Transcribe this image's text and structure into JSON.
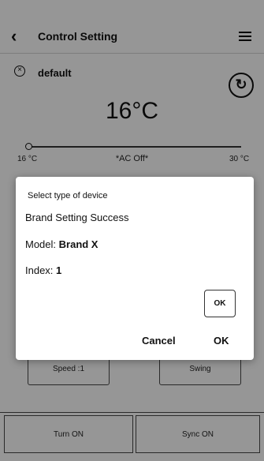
{
  "header": {
    "title": "Control Setting",
    "back_icon": "chevron-left-icon",
    "menu_icon": "hamburger-menu-icon"
  },
  "control": {
    "preset_name": "default",
    "temperature": "16°C",
    "slider_min": "16 °C",
    "slider_max": "30 °C",
    "status": "*AC Off*",
    "slider_value_c": 16
  },
  "buttons": {
    "speed": "Speed :1",
    "swing": "Swing",
    "turn_on": "Turn ON",
    "sync_on": "Sync ON"
  },
  "dialog": {
    "title": "Select type of device",
    "message": "Brand Setting Success",
    "model_label": "Model: ",
    "model_value": "Brand X",
    "index_label": "Index: ",
    "index_value": "1",
    "ok_small": "OK",
    "cancel": "Cancel",
    "ok": "OK"
  },
  "colors": {
    "background": "#f2f2f2",
    "overlay": "rgba(0,0,0,0.38)",
    "dialog": "#ffffff",
    "text": "#111111"
  }
}
